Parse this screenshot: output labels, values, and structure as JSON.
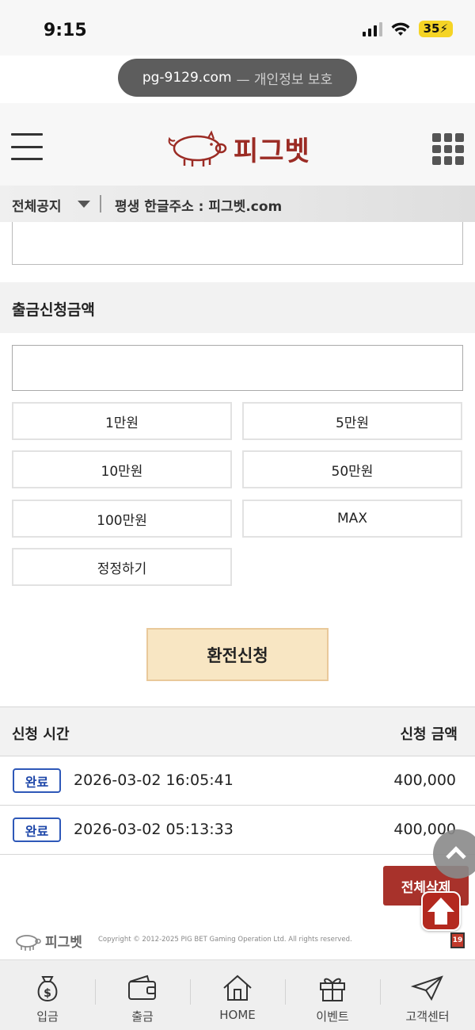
{
  "status_bar": {
    "time": "9:15",
    "battery": "35"
  },
  "browser": {
    "url": "pg-9129.com",
    "privacy_text": "— 개인정보 보호"
  },
  "header": {
    "brand": "피그벳"
  },
  "notice": {
    "label": "전체공지",
    "text": "평생 한글주소 : 피그벳.com"
  },
  "withdraw": {
    "section_title": "출금신청금액",
    "amount_input_value": "",
    "amount_buttons": [
      "1만원",
      "5만원",
      "10만원",
      "50만원",
      "100만원",
      "MAX",
      "정정하기"
    ],
    "apply_label": "환전신청"
  },
  "history": {
    "col_time": "신청 시간",
    "col_amount": "신청 금액",
    "rows": [
      {
        "status": "완료",
        "time": "2026-03-02 16:05:41",
        "amount": "400,000"
      },
      {
        "status": "완료",
        "time": "2026-03-02 05:13:33",
        "amount": "400,000"
      }
    ],
    "delete_all_label": "전체삭제"
  },
  "footer": {
    "brand": "피그벳",
    "copyright": "Copyright © 2012-2025 PIG BET Gaming Operation Ltd. All rights reserved.",
    "age_badge": "19"
  },
  "tabbar": [
    {
      "label": "입금",
      "icon": "money-bag-icon"
    },
    {
      "label": "출금",
      "icon": "wallet-icon"
    },
    {
      "label": "HOME",
      "icon": "home-icon"
    },
    {
      "label": "이벤트",
      "icon": "gift-icon"
    },
    {
      "label": "고객센터",
      "icon": "paper-plane-icon"
    }
  ],
  "colors": {
    "brand": "#9b2b24",
    "accent_button": "#f8e6c3",
    "badge_blue": "#2e58b8",
    "delete_red": "#a8322b"
  }
}
